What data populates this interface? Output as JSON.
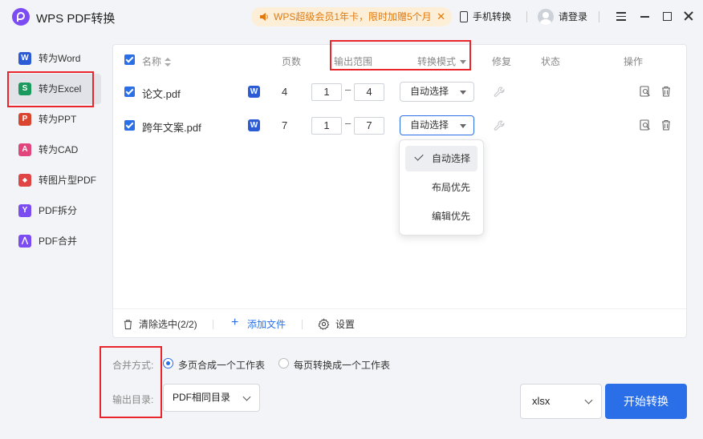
{
  "app": {
    "title": "WPS PDF转换"
  },
  "header": {
    "promo": "WPS超级会员1年卡，限时加赠5个月",
    "phone_convert": "手机转换",
    "login": "请登录"
  },
  "sidebar": {
    "items": [
      {
        "label": "转为Word",
        "icon_text": "W",
        "color": "#2b5cd6"
      },
      {
        "label": "转为Excel",
        "icon_text": "S",
        "color": "#1a9a5c"
      },
      {
        "label": "转为PPT",
        "icon_text": "P",
        "color": "#d9452e"
      },
      {
        "label": "转为CAD",
        "icon_text": "A",
        "color": "#e0457b"
      },
      {
        "label": "转图片型PDF",
        "icon_text": "◆",
        "color": "#e04545"
      },
      {
        "label": "PDF拆分",
        "icon_text": "Y",
        "color": "#7b4cf1"
      },
      {
        "label": "PDF合并",
        "icon_text": "⋀",
        "color": "#7b4cf1"
      }
    ]
  },
  "table": {
    "headers": {
      "name": "名称",
      "pages": "页数",
      "range": "输出范围",
      "mode": "转换模式",
      "repair": "修复",
      "status": "状态",
      "actions": "操作"
    },
    "rows": [
      {
        "name": "论文.pdf",
        "type_icon": "W",
        "pages": "4",
        "from": "1",
        "to": "4",
        "mode": "自动选择"
      },
      {
        "name": "跨年文案.pdf",
        "type_icon": "W",
        "pages": "7",
        "from": "1",
        "to": "7",
        "mode": "自动选择"
      }
    ],
    "range_sep": "–"
  },
  "dropdown": {
    "options": [
      "自动选择",
      "布局优先",
      "编辑优先"
    ],
    "selected": "自动选择"
  },
  "toolbar": {
    "clear": "清除选中(2/2)",
    "add": "添加文件",
    "settings": "设置"
  },
  "options": {
    "merge_label": "合并方式:",
    "merge_opt1": "多页合成一个工作表",
    "merge_opt2": "每页转换成一个工作表",
    "output_label": "输出目录:",
    "output_value": "PDF相同目录",
    "format": "xlsx",
    "start": "开始转换"
  },
  "colors": {
    "accent": "#2a6ee8",
    "annotation": "#e8262b",
    "promo_text": "#e07a10"
  }
}
